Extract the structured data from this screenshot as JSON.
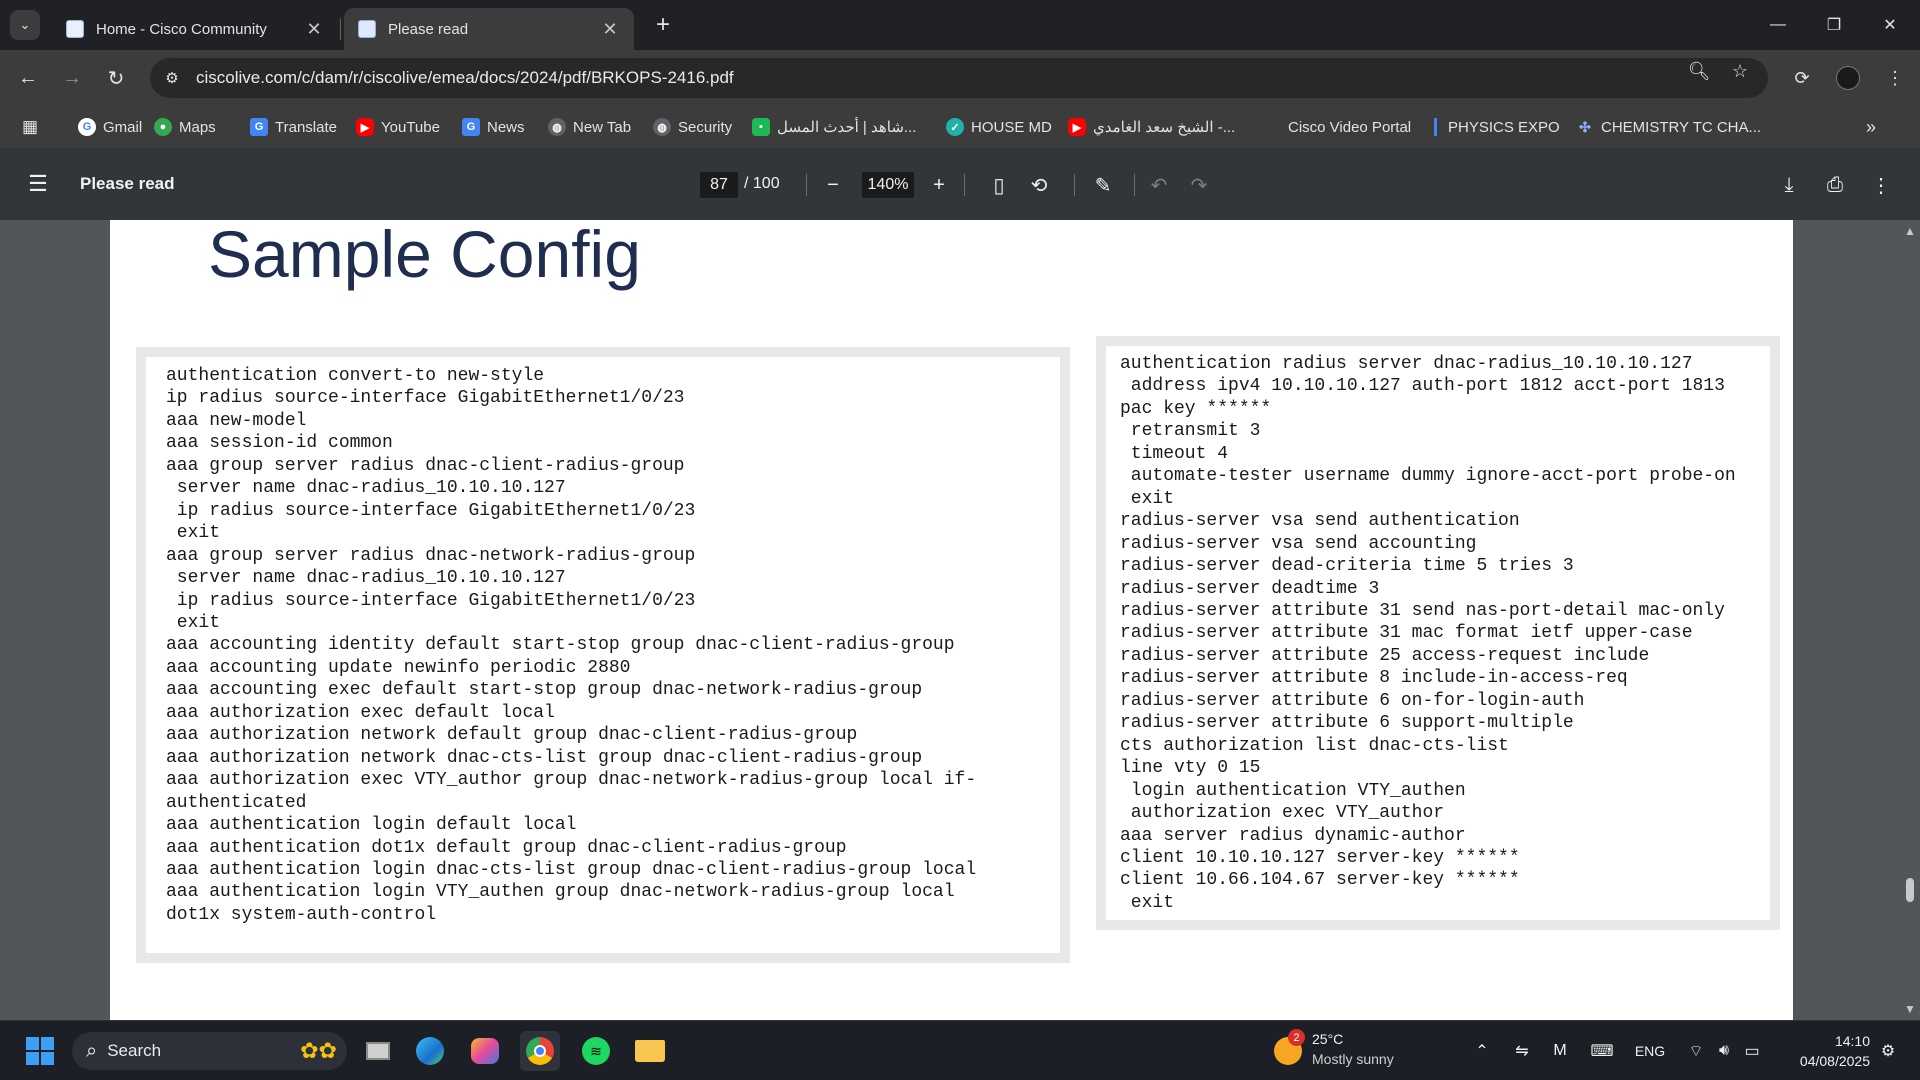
{
  "browser": {
    "tabs": [
      {
        "title": "Home - Cisco Community",
        "close": "✕"
      },
      {
        "title": "Please read",
        "close": "✕"
      }
    ],
    "new_tab": "+",
    "url": "ciscolive.com/c/dam/r/ciscolive/emea/docs/2024/pdf/BRKOPS-2416.pdf"
  },
  "bookmarks": [
    {
      "label": "Gmail",
      "icon": "google-icon",
      "color": "#4285f4"
    },
    {
      "label": "Maps",
      "icon": "maps-icon",
      "color": "#34a853"
    },
    {
      "label": "Translate",
      "icon": "translate-icon",
      "color": "#4285f4"
    },
    {
      "label": "YouTube",
      "icon": "youtube-icon",
      "color": "#ff0000"
    },
    {
      "label": "News",
      "icon": "news-icon",
      "color": "#4285f4"
    },
    {
      "label": "New Tab",
      "icon": "globe-icon",
      "color": "#9aa0a6"
    },
    {
      "label": "Security",
      "icon": "globe-icon",
      "color": "#9aa0a6"
    },
    {
      "label": "شاهد | أحدث المسل...",
      "icon": "shahid-icon",
      "color": "#1db954"
    },
    {
      "label": "HOUSE MD",
      "icon": "house-md-icon",
      "color": "#20b2aa"
    },
    {
      "label": "الشيخ سعد الغامدي -...",
      "icon": "youtube-icon",
      "color": "#ff0000"
    },
    {
      "label": "Cisco Video Portal",
      "icon": "",
      "color": ""
    },
    {
      "label": "PHYSICS EXPO",
      "icon": "expo-icon",
      "color": "#4285f4"
    },
    {
      "label": "CHEMISTRY TC CHA...",
      "icon": "molecule-icon",
      "color": "#4285f4"
    }
  ],
  "pdf": {
    "title": "Please read",
    "current_page": "87",
    "total_pages": "/ 100",
    "zoom": "140%"
  },
  "slide": {
    "title": "Sample Config",
    "left_code": "authentication convert-to new-style\nip radius source-interface GigabitEthernet1/0/23\naaa new-model\naaa session-id common\naaa group server radius dnac-client-radius-group\n server name dnac-radius_10.10.10.127\n ip radius source-interface GigabitEthernet1/0/23\n exit\naaa group server radius dnac-network-radius-group\n server name dnac-radius_10.10.10.127\n ip radius source-interface GigabitEthernet1/0/23\n exit\naaa accounting identity default start-stop group dnac-client-radius-group\naaa accounting update newinfo periodic 2880\naaa accounting exec default start-stop group dnac-network-radius-group\naaa authorization exec default local\naaa authorization network default group dnac-client-radius-group\naaa authorization network dnac-cts-list group dnac-client-radius-group\naaa authorization exec VTY_author group dnac-network-radius-group local if-\nauthenticated\naaa authentication login default local\naaa authentication dot1x default group dnac-client-radius-group\naaa authentication login dnac-cts-list group dnac-client-radius-group local\naaa authentication login VTY_authen group dnac-network-radius-group local\ndot1x system-auth-control",
    "right_code": "authentication radius server dnac-radius_10.10.10.127\n address ipv4 10.10.10.127 auth-port 1812 acct-port 1813\npac key ******\n retransmit 3\n timeout 4\n automate-tester username dummy ignore-acct-port probe-on\n exit\nradius-server vsa send authentication\nradius-server vsa send accounting\nradius-server dead-criteria time 5 tries 3\nradius-server deadtime 3\nradius-server attribute 31 send nas-port-detail mac-only\nradius-server attribute 31 mac format ietf upper-case\nradius-server attribute 25 access-request include\nradius-server attribute 8 include-in-access-req\nradius-server attribute 6 on-for-login-auth\nradius-server attribute 6 support-multiple\ncts authorization list dnac-cts-list\nline vty 0 15\n login authentication VTY_authen\n authorization exec VTY_author\naaa server radius dynamic-author\nclient 10.10.10.127 server-key ******\nclient 10.66.104.67 server-key ******\n exit"
  },
  "taskbar": {
    "search_label": "Search",
    "weather_badge": "2",
    "temperature": "25°C",
    "condition": "Mostly sunny",
    "language": "ENG",
    "time": "14:10",
    "date": "04/08/2025"
  },
  "colors": {
    "slide_title": "#1f2d4e",
    "tab_bar": "#202124",
    "toolbar": "#3c3c3c",
    "pdf_bar": "#323639",
    "viewer_bg": "#525659"
  }
}
